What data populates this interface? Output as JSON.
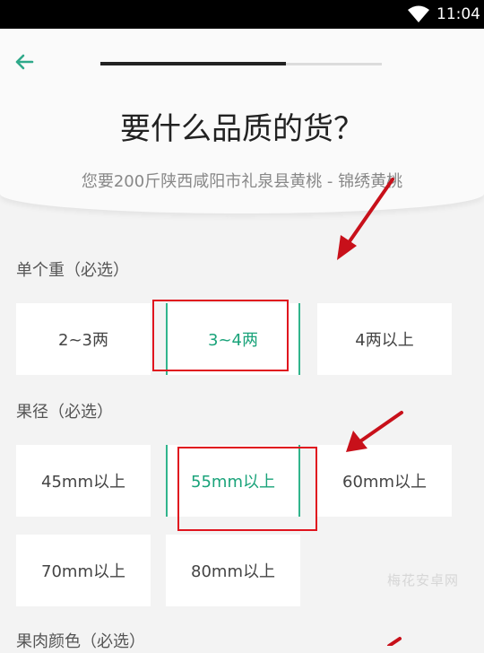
{
  "status_bar": {
    "time": "11:04",
    "wifi_icon": "wifi-icon"
  },
  "header": {
    "back_icon": "arrow-left-icon",
    "progress_fraction": 0.66,
    "title": "要什么品质的货？",
    "subtitle": "您要200斤陕西咸阳市礼泉县黄桃 - 锦绣黄桃"
  },
  "sections": {
    "weight": {
      "label": "单个重（必选）",
      "options": [
        "2~3两",
        "3~4两",
        "4两以上"
      ],
      "selected": "3~4两"
    },
    "diameter": {
      "label": "果径（必选）",
      "options": [
        "45mm以上",
        "55mm以上",
        "60mm以上",
        "70mm以上",
        "80mm以上"
      ],
      "selected": "55mm以上"
    },
    "flesh_color": {
      "label": "果肉颜色（必选）"
    }
  },
  "watermark": "梅花安卓网",
  "colors": {
    "accent": "#31b48c",
    "annotation": "#e0141e"
  }
}
